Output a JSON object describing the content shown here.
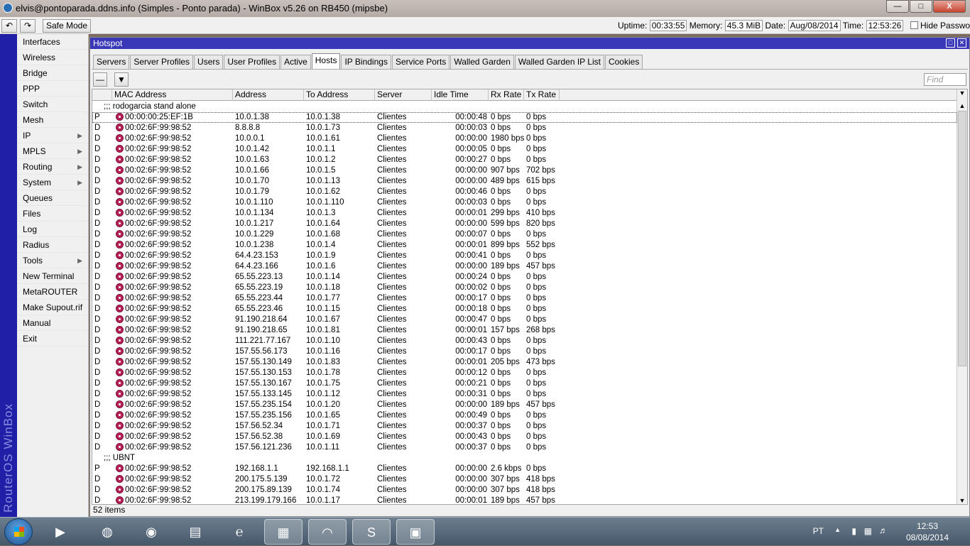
{
  "window": {
    "title": "elvis@pontoparada.ddns.info (Simples - Ponto parada) - WinBox v5.26 on RB450 (mipsbe)",
    "buttons": {
      "minimize": "—",
      "maximize": "□",
      "close": "X"
    }
  },
  "toolbar": {
    "undo_icon": "undo-icon",
    "redo_icon": "redo-icon",
    "safe_mode": "Safe Mode",
    "uptime_label": "Uptime:",
    "uptime": "00:33:55",
    "memory_label": "Memory:",
    "memory": "45.3 MiB",
    "date_label": "Date:",
    "date": "Aug/08/2014",
    "time_label": "Time:",
    "time": "12:53:26",
    "hide_passwords": "Hide Passwords"
  },
  "brand": "RouterOS WinBox",
  "menu": [
    {
      "label": "Interfaces",
      "arrow": false
    },
    {
      "label": "Wireless",
      "arrow": false
    },
    {
      "label": "Bridge",
      "arrow": false
    },
    {
      "label": "PPP",
      "arrow": false
    },
    {
      "label": "Switch",
      "arrow": false
    },
    {
      "label": "Mesh",
      "arrow": false
    },
    {
      "label": "IP",
      "arrow": true
    },
    {
      "label": "MPLS",
      "arrow": true
    },
    {
      "label": "Routing",
      "arrow": true
    },
    {
      "label": "System",
      "arrow": true
    },
    {
      "label": "Queues",
      "arrow": false
    },
    {
      "label": "Files",
      "arrow": false
    },
    {
      "label": "Log",
      "arrow": false
    },
    {
      "label": "Radius",
      "arrow": false
    },
    {
      "label": "Tools",
      "arrow": true
    },
    {
      "label": "New Terminal",
      "arrow": false
    },
    {
      "label": "MetaROUTER",
      "arrow": false
    },
    {
      "label": "Make Supout.rif",
      "arrow": false
    },
    {
      "label": "Manual",
      "arrow": false
    },
    {
      "label": "Exit",
      "arrow": false
    }
  ],
  "hotspot": {
    "title": "Hotspot",
    "tabs": [
      "Servers",
      "Server Profiles",
      "Users",
      "User Profiles",
      "Active",
      "Hosts",
      "IP Bindings",
      "Service Ports",
      "Walled Garden",
      "Walled Garden IP List",
      "Cookies"
    ],
    "active_tab": "Hosts",
    "find_placeholder": "Find",
    "columns": [
      "MAC Address",
      "Address",
      "To Address",
      "Server",
      "Idle Time",
      "Rx Rate",
      "Tx Rate"
    ],
    "groups": [
      {
        "name": ";;; rodogarcia stand alone",
        "rows": [
          [
            "P",
            "00:00:00:25:EF:1B",
            "10.0.1.38",
            "10.0.1.38",
            "Clientes",
            "00:00:48",
            "0 bps",
            "0 bps"
          ],
          [
            "D",
            "00:02:6F:99:98:52",
            "8.8.8.8",
            "10.0.1.73",
            "Clientes",
            "00:00:03",
            "0 bps",
            "0 bps"
          ],
          [
            "D",
            "00:02:6F:99:98:52",
            "10.0.0.1",
            "10.0.1.61",
            "Clientes",
            "00:00:00",
            "1980 bps",
            "0 bps"
          ],
          [
            "D",
            "00:02:6F:99:98:52",
            "10.0.1.42",
            "10.0.1.1",
            "Clientes",
            "00:00:05",
            "0 bps",
            "0 bps"
          ],
          [
            "D",
            "00:02:6F:99:98:52",
            "10.0.1.63",
            "10.0.1.2",
            "Clientes",
            "00:00:27",
            "0 bps",
            "0 bps"
          ],
          [
            "D",
            "00:02:6F:99:98:52",
            "10.0.1.66",
            "10.0.1.5",
            "Clientes",
            "00:00:00",
            "907 bps",
            "702 bps"
          ],
          [
            "D",
            "00:02:6F:99:98:52",
            "10.0.1.70",
            "10.0.1.13",
            "Clientes",
            "00:00:00",
            "489 bps",
            "615 bps"
          ],
          [
            "D",
            "00:02:6F:99:98:52",
            "10.0.1.79",
            "10.0.1.62",
            "Clientes",
            "00:00:46",
            "0 bps",
            "0 bps"
          ],
          [
            "D",
            "00:02:6F:99:98:52",
            "10.0.1.110",
            "10.0.1.110",
            "Clientes",
            "00:00:03",
            "0 bps",
            "0 bps"
          ],
          [
            "D",
            "00:02:6F:99:98:52",
            "10.0.1.134",
            "10.0.1.3",
            "Clientes",
            "00:00:01",
            "299 bps",
            "410 bps"
          ],
          [
            "D",
            "00:02:6F:99:98:52",
            "10.0.1.217",
            "10.0.1.64",
            "Clientes",
            "00:00:00",
            "599 bps",
            "820 bps"
          ],
          [
            "D",
            "00:02:6F:99:98:52",
            "10.0.1.229",
            "10.0.1.68",
            "Clientes",
            "00:00:07",
            "0 bps",
            "0 bps"
          ],
          [
            "D",
            "00:02:6F:99:98:52",
            "10.0.1.238",
            "10.0.1.4",
            "Clientes",
            "00:00:01",
            "899 bps",
            "552 bps"
          ],
          [
            "D",
            "00:02:6F:99:98:52",
            "64.4.23.153",
            "10.0.1.9",
            "Clientes",
            "00:00:41",
            "0 bps",
            "0 bps"
          ],
          [
            "D",
            "00:02:6F:99:98:52",
            "64.4.23.166",
            "10.0.1.6",
            "Clientes",
            "00:00:00",
            "189 bps",
            "457 bps"
          ],
          [
            "D",
            "00:02:6F:99:98:52",
            "65.55.223.13",
            "10.0.1.14",
            "Clientes",
            "00:00:24",
            "0 bps",
            "0 bps"
          ],
          [
            "D",
            "00:02:6F:99:98:52",
            "65.55.223.19",
            "10.0.1.18",
            "Clientes",
            "00:00:02",
            "0 bps",
            "0 bps"
          ],
          [
            "D",
            "00:02:6F:99:98:52",
            "65.55.223.44",
            "10.0.1.77",
            "Clientes",
            "00:00:17",
            "0 bps",
            "0 bps"
          ],
          [
            "D",
            "00:02:6F:99:98:52",
            "65.55.223.46",
            "10.0.1.15",
            "Clientes",
            "00:00:18",
            "0 bps",
            "0 bps"
          ],
          [
            "D",
            "00:02:6F:99:98:52",
            "91.190.218.64",
            "10.0.1.67",
            "Clientes",
            "00:00:47",
            "0 bps",
            "0 bps"
          ],
          [
            "D",
            "00:02:6F:99:98:52",
            "91.190.218.65",
            "10.0.1.81",
            "Clientes",
            "00:00:01",
            "157 bps",
            "268 bps"
          ],
          [
            "D",
            "00:02:6F:99:98:52",
            "111.221.77.167",
            "10.0.1.10",
            "Clientes",
            "00:00:43",
            "0 bps",
            "0 bps"
          ],
          [
            "D",
            "00:02:6F:99:98:52",
            "157.55.56.173",
            "10.0.1.16",
            "Clientes",
            "00:00:17",
            "0 bps",
            "0 bps"
          ],
          [
            "D",
            "00:02:6F:99:98:52",
            "157.55.130.149",
            "10.0.1.83",
            "Clientes",
            "00:00:01",
            "205 bps",
            "473 bps"
          ],
          [
            "D",
            "00:02:6F:99:98:52",
            "157.55.130.153",
            "10.0.1.78",
            "Clientes",
            "00:00:12",
            "0 bps",
            "0 bps"
          ],
          [
            "D",
            "00:02:6F:99:98:52",
            "157.55.130.167",
            "10.0.1.75",
            "Clientes",
            "00:00:21",
            "0 bps",
            "0 bps"
          ],
          [
            "D",
            "00:02:6F:99:98:52",
            "157.55.133.145",
            "10.0.1.12",
            "Clientes",
            "00:00:31",
            "0 bps",
            "0 bps"
          ],
          [
            "D",
            "00:02:6F:99:98:52",
            "157.55.235.154",
            "10.0.1.20",
            "Clientes",
            "00:00:00",
            "189 bps",
            "457 bps"
          ],
          [
            "D",
            "00:02:6F:99:98:52",
            "157.55.235.156",
            "10.0.1.65",
            "Clientes",
            "00:00:49",
            "0 bps",
            "0 bps"
          ],
          [
            "D",
            "00:02:6F:99:98:52",
            "157.56.52.34",
            "10.0.1.71",
            "Clientes",
            "00:00:37",
            "0 bps",
            "0 bps"
          ],
          [
            "D",
            "00:02:6F:99:98:52",
            "157.56.52.38",
            "10.0.1.69",
            "Clientes",
            "00:00:43",
            "0 bps",
            "0 bps"
          ],
          [
            "D",
            "00:02:6F:99:98:52",
            "157.56.121.236",
            "10.0.1.11",
            "Clientes",
            "00:00:37",
            "0 bps",
            "0 bps"
          ]
        ]
      },
      {
        "name": ";;; UBNT",
        "rows": [
          [
            "P",
            "00:02:6F:99:98:52",
            "192.168.1.1",
            "192.168.1.1",
            "Clientes",
            "00:00:00",
            "2.6 kbps",
            "0 bps"
          ],
          [
            "D",
            "00:02:6F:99:98:52",
            "200.175.5.139",
            "10.0.1.72",
            "Clientes",
            "00:00:00",
            "307 bps",
            "418 bps"
          ],
          [
            "D",
            "00:02:6F:99:98:52",
            "200.175.89.139",
            "10.0.1.74",
            "Clientes",
            "00:00:00",
            "307 bps",
            "418 bps"
          ],
          [
            "D",
            "00:02:6F:99:98:52",
            "213.199.179.166",
            "10.0.1.17",
            "Clientes",
            "00:00:01",
            "189 bps",
            "457 bps"
          ]
        ]
      }
    ],
    "item_count": "52 items"
  },
  "taskbar": {
    "apps": [
      "media-player-icon",
      "globe-download-icon",
      "chrome-icon",
      "explorer-folder-icon",
      "ie-icon",
      "remote-desktop-icon",
      "winbox-icon",
      "skype-icon",
      "window-app-icon"
    ],
    "language": "PT",
    "clock_time": "12:53",
    "clock_date": "08/08/2014"
  }
}
